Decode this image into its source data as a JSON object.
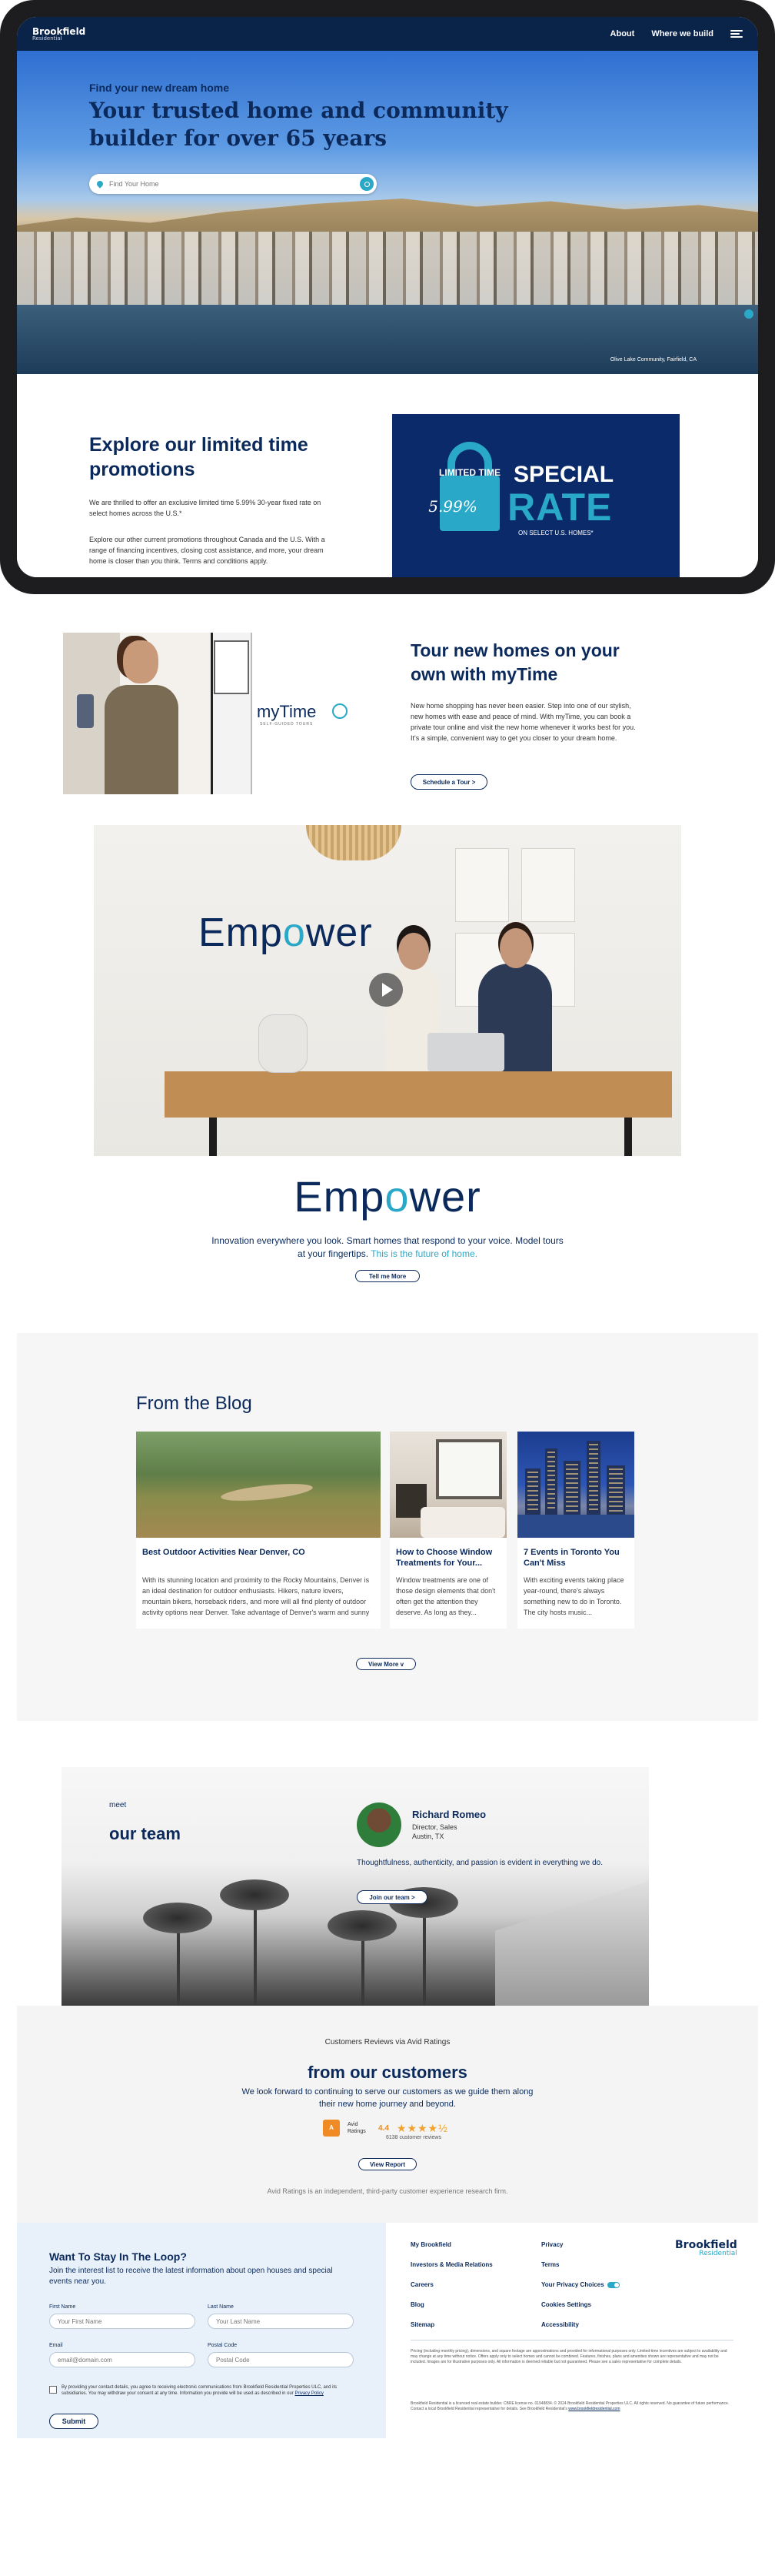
{
  "header": {
    "logo_line1": "Brookfield",
    "logo_line2": "Residential",
    "nav": [
      "About",
      "Where we build"
    ]
  },
  "hero": {
    "subtitle": "Find your new dream home",
    "title": "Your trusted home and community builder for over 65 years",
    "search_placeholder": "Find Your Home",
    "caption": "Olive Lake Community, Fairfield, CA"
  },
  "promo": {
    "title": "Explore our limited time promotions",
    "p1": "We are thrilled to offer an exclusive limited time 5.99% 30-year fixed rate on select homes across the U.S.*",
    "p2": "Explore our other current promotions throughout Canada and the U.S. With a range of financing incentives, closing cost assistance, and more, your dream home is closer than you think. Terms and conditions apply.",
    "badge_limited": "LIMITED TIME",
    "badge_rate": "5.99%",
    "badge_special": "SPECIAL",
    "badge_rate_word": "RATE",
    "badge_note": "ON SELECT U.S. HOMES*"
  },
  "mytime": {
    "logo": "myTime",
    "logo_tag": "SELF-GUIDED TOURS",
    "title": "Tour new homes on your own with myTime",
    "text": "New home shopping has never been easier. Step into one of our stylish, new homes with ease and peace of mind. With myTime, you can book a private tour online and visit the new home whenever it works best for you. It's a simple, convenient way to get you closer to your dream home.",
    "button": "Schedule a Tour  >"
  },
  "empower": {
    "word_a": "Emp",
    "word_o": "o",
    "word_b": "wer",
    "line1": "Innovation everywhere you look. Smart homes that respond to your voice. Model tours",
    "line2_a": "at your fingertips. ",
    "line2_b": "This is the future of home.",
    "button": "Tell me More"
  },
  "blog": {
    "title": "From the Blog",
    "posts": [
      {
        "title": "Best Outdoor Activities Near Denver, CO",
        "text": "With its stunning location and proximity to the Rocky Mountains, Denver is an ideal destination for outdoor enthusiasts. Hikers, nature lovers, mountain bikers, horseback riders, and more will all find plenty of outdoor activity options near Denver. Take advantage of Denver's warm and sunny summers as well as its snowy winters a..."
      },
      {
        "title": "How to Choose Window Treatments for Your...",
        "text": "Window treatments are one of those design elements that don't often get the attention they deserve. As long as they..."
      },
      {
        "title": "7 Events in Toronto You Can't Miss",
        "text": "With exciting events taking place year-round, there's always something new to do in Toronto. The city hosts music..."
      }
    ],
    "button": "View More  v"
  },
  "team": {
    "meet": "meet",
    "title": "our team",
    "name": "Richard Romeo",
    "role": "Director, Sales",
    "location": "Austin, TX",
    "quote": "Thoughtfulness, authenticity, and passion is evident in everything we do.",
    "button": "Join our team  >"
  },
  "reviews": {
    "kicker": "Customers Reviews via Avid Ratings",
    "title": "from our customers",
    "text1": "We look forward to continuing to serve our customers as we guide them along",
    "text2": "their new home journey and beyond.",
    "avid_logo": "A",
    "avid_name": "Avid Ratings",
    "score": "4.4",
    "stars": "★★★★½",
    "count": "6138 customer reviews",
    "button": "View Report",
    "footnote": "Avid Ratings is an independent, third-party customer experience research firm."
  },
  "signup": {
    "title": "Want To Stay In The Loop?",
    "text": "Join the interest list to receive the latest information about open houses and special events near you.",
    "first_label": "First Name",
    "first_ph": "Your First Name",
    "last_label": "Last Name",
    "last_ph": "Your Last Name",
    "email_label": "Email",
    "email_ph": "email@domain.com",
    "postal_label": "Postal Code",
    "postal_ph": "Postal Code",
    "consent": "By providing your contact details, you agree to receiving electronic communications from Brookfield Residential Properties ULC, and its subsidiaries. You may withdraw your consent at any time. Information you provide will be used as described in our ",
    "consent_link": "Privacy Policy",
    "submit": "Submit"
  },
  "footer": {
    "col1": [
      "My Brookfield",
      "Investors & Media Relations",
      "Careers",
      "Blog",
      "Sitemap"
    ],
    "col2": [
      "Privacy",
      "Terms",
      "Your Privacy Choices",
      "Cookies Settings",
      "Accessibility"
    ],
    "logo_line1": "Brookfield",
    "logo_line2": "Residential",
    "legal1": "Pricing (including monthly pricing), dimensions, and square footage are approximations and provided for informational purposes only. Limited-time incentives are subject to availability and may change at any time without notice. Offers apply only to select homes and cannot be combined. Features, finishes, plans and amenities shown are representative and may not be included. Images are for illustrative purposes only. All information is deemed reliable but not guaranteed. Please see a sales representative for complete details.",
    "legal2": "Brookfield Residential is a licensed real estate builder. CBRE license no. 01948834. © 2024 Brookfield Residential Properties ULC. All rights reserved. No guarantee of future performance. Contact a local Brookfield Residential representative for details. See Brookfield Residential's ",
    "legal_link": "www.brookfieldresidential.com"
  }
}
